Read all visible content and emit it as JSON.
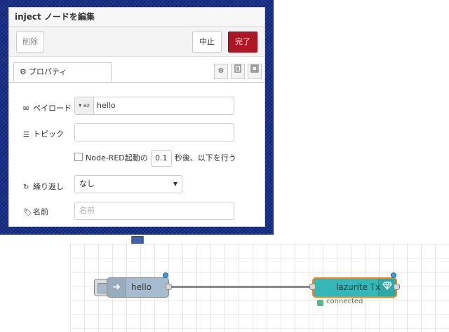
{
  "dialog": {
    "title": "inject ノードを編集",
    "delete_label": "削除",
    "cancel_label": "中止",
    "done_label": "完了",
    "tab_properties": "プロパティ",
    "tab_icons": [
      "gear-icon",
      "document-icon",
      "layout-icon"
    ]
  },
  "form": {
    "payload_label": "ペイロード",
    "payload_type_icon": "az",
    "payload_value": "hello",
    "topic_label": "トピック",
    "topic_value": "",
    "startup_prefix": "Node-RED起動の",
    "startup_delay": "0.1",
    "startup_suffix": "秒後、以下を行う",
    "repeat_label": "繰り返し",
    "repeat_value": "なし",
    "name_label": "名前",
    "name_placeholder": "名前"
  },
  "flow": {
    "inject_node_label": "hello",
    "tx_node_label": "lazurite Tx",
    "tx_status": "connected"
  },
  "colors": {
    "done_button": "#ad1625",
    "inject_node": "#a6bbcf",
    "tx_node": "#35b7b7",
    "selected_border": "#ff7f0e",
    "status_green": "#5fb48d"
  }
}
